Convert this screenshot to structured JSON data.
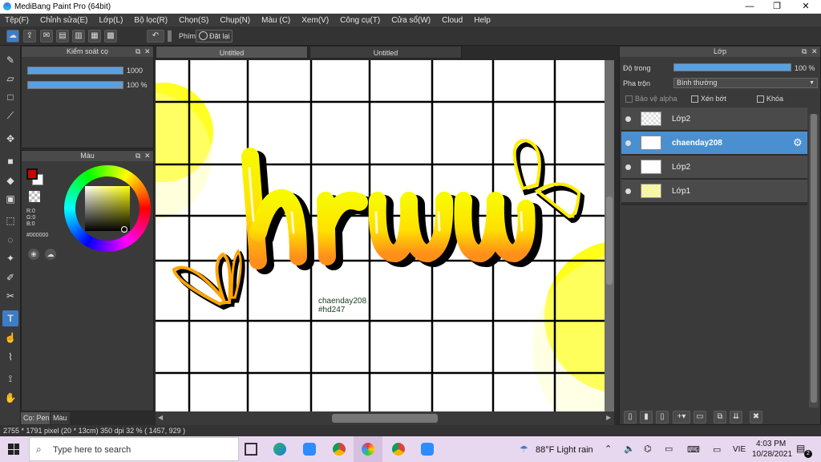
{
  "window": {
    "title": "MediBang Paint Pro (64bit)",
    "minimize": "—",
    "maximize": "❐",
    "close": "✕"
  },
  "menu": [
    "Tệp(F)",
    "Chỉnh sửa(E)",
    "Lớp(L)",
    "Bộ lọc(R)",
    "Chọn(S)",
    "Chụp(N)",
    "Màu (C)",
    "Xem(V)",
    "Công cụ(T)",
    "Cửa sổ(W)",
    "Cloud",
    "Help"
  ],
  "toolbar": {
    "undo_icon": "undo-icon",
    "key_label": "Phím",
    "reset_label": "Đặt lại"
  },
  "brush_panel": {
    "title": "Kiểm soát cọ",
    "size_value": "1000",
    "opacity_value": "100 %"
  },
  "color_panel": {
    "title": "Màu",
    "r": "R:0",
    "g": "G:0",
    "b": "B:0",
    "hex": "#000000",
    "primary_color": "#cc0000",
    "secondary_color": "#ffffff"
  },
  "panel_tabs": {
    "left_tab": "Cọ: Pen",
    "right_tab": "Màu"
  },
  "tabs": [
    {
      "label": "Untitled"
    },
    {
      "label": "Untitled"
    }
  ],
  "canvas": {
    "watermark_line1": "chaenday208",
    "watermark_line2": "#hd247"
  },
  "layer_panel": {
    "title": "Lớp",
    "opacity_label": "Độ trong",
    "opacity_value": "100 %",
    "blend_label": "Pha trộn",
    "blend_value": "Bình thường",
    "protect_alpha": "Bảo vệ alpha",
    "clip": "Xén bớt",
    "lock": "Khóa",
    "layers": [
      {
        "name": "Lớp2"
      },
      {
        "name": "chaenday208"
      },
      {
        "name": "Lớp2"
      },
      {
        "name": "Lớp1"
      }
    ]
  },
  "status": {
    "text": "2755 * 1791 pixel   (20 * 13cm)   350 dpi   32 %   ( 1457, 929 )"
  },
  "taskbar": {
    "search_placeholder": "Type here to search",
    "weather": "88°F  Light rain",
    "lang": "VIE",
    "time": "4:03 PM",
    "date": "10/28/2021",
    "notif_count": "2"
  }
}
